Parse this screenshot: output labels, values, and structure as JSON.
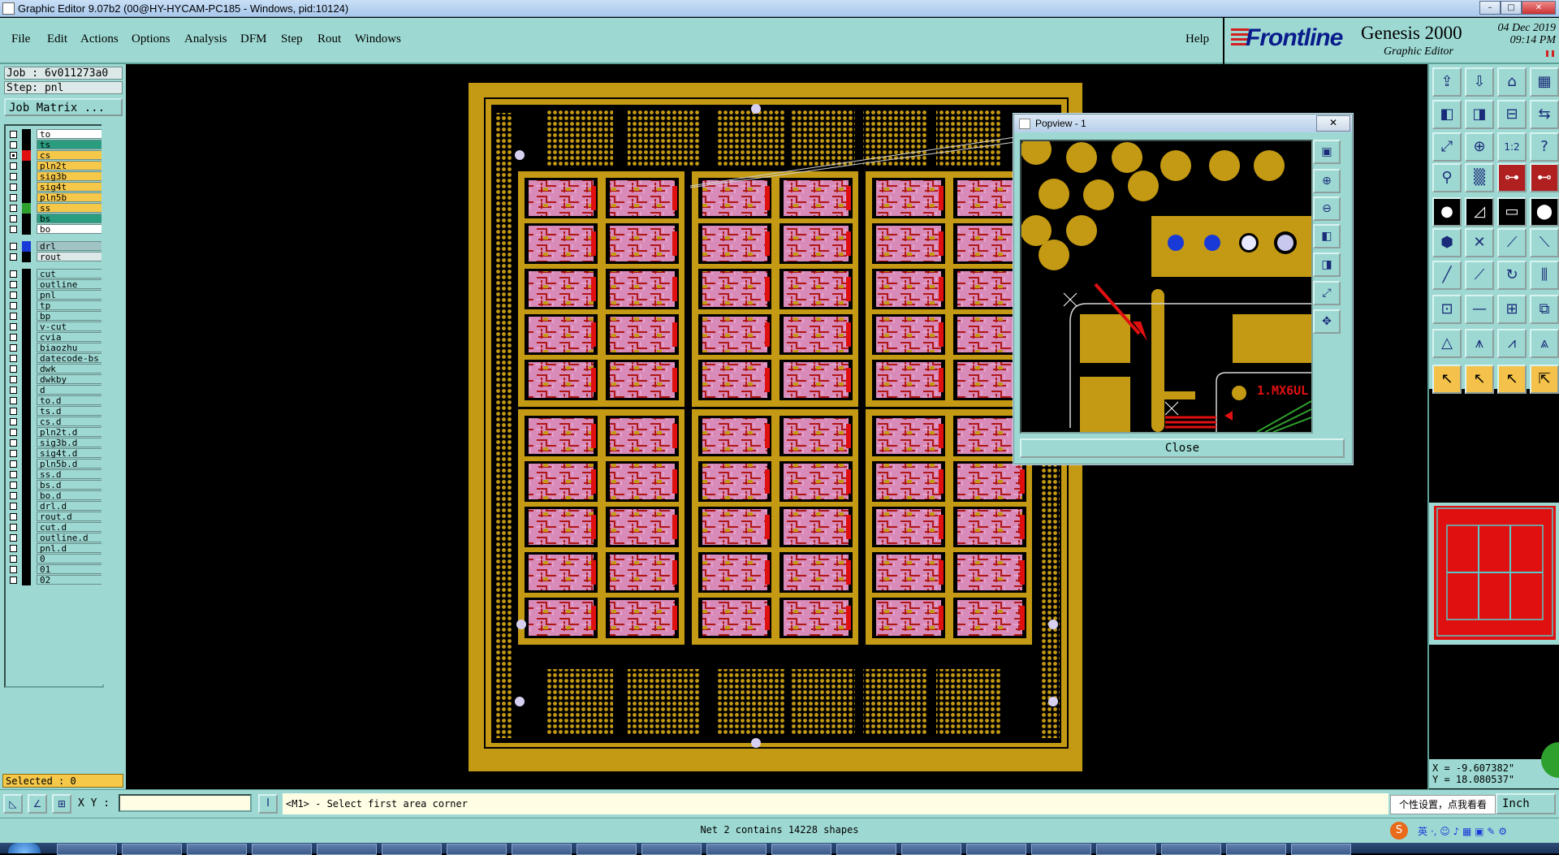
{
  "window": {
    "title": "Graphic Editor 9.07b2 (00@HY-HYCAM-PC185 - Windows, pid:10124)"
  },
  "menu": [
    {
      "label": "File",
      "key": "file"
    },
    {
      "label": "Edit",
      "key": "edit"
    },
    {
      "label": "Actions",
      "key": "actions"
    },
    {
      "label": "Options",
      "key": "options"
    },
    {
      "label": "Analysis",
      "key": "analysis"
    },
    {
      "label": "DFM",
      "key": "dfm"
    },
    {
      "label": "Step",
      "key": "step"
    },
    {
      "label": "Rout",
      "key": "rout"
    },
    {
      "label": "Windows",
      "key": "windows"
    }
  ],
  "help_label": "Help",
  "brand": {
    "logo": "Frontline",
    "product": "Genesis 2000",
    "subtitle": "Graphic Editor",
    "date": "04 Dec 2019",
    "time": "09:14 PM"
  },
  "job": {
    "job_label": "Job : 6v011273a0",
    "step_label": "Step: pnl",
    "matrix_button": "Job Matrix ..."
  },
  "layers": [
    {
      "name": "to",
      "color": "#ffffff",
      "swatch": "#000000",
      "checked": false
    },
    {
      "name": "ts",
      "color": "#2a9d80",
      "swatch": "#000000",
      "checked": false
    },
    {
      "name": "cs",
      "color": "#f6c849",
      "swatch": "#e01010",
      "checked": true
    },
    {
      "name": "pln2t",
      "color": "#f6c849",
      "swatch": "#000000",
      "checked": false
    },
    {
      "name": "sig3b",
      "color": "#f6c849",
      "swatch": "#000000",
      "checked": false
    },
    {
      "name": "sig4t",
      "color": "#f6c849",
      "swatch": "#000000",
      "checked": false
    },
    {
      "name": "pln5b",
      "color": "#f6c849",
      "swatch": "#000000",
      "checked": false
    },
    {
      "name": "ss",
      "color": "#f6c849",
      "swatch": "#2ea02e",
      "checked": false
    },
    {
      "name": "bs",
      "color": "#2a9d80",
      "swatch": "#000000",
      "checked": false
    },
    {
      "name": "bo",
      "color": "#ffffff",
      "swatch": "#000000",
      "checked": false
    },
    {
      "name": "drl",
      "color": "#a0c4c4",
      "swatch": "#1a3ad8",
      "checked": false
    },
    {
      "name": "rout",
      "color": "#dde9e8",
      "swatch": "#000000",
      "checked": false
    },
    {
      "name": "cut",
      "color": "#9dd9d2",
      "swatch": "#000000",
      "checked": false
    },
    {
      "name": "outline",
      "color": "#9dd9d2",
      "swatch": "#000000",
      "checked": false
    },
    {
      "name": "pnl",
      "color": "#9dd9d2",
      "swatch": "#000000",
      "checked": false
    },
    {
      "name": "tp",
      "color": "#9dd9d2",
      "swatch": "#000000",
      "checked": false
    },
    {
      "name": "bp",
      "color": "#9dd9d2",
      "swatch": "#000000",
      "checked": false
    },
    {
      "name": "v-cut",
      "color": "#9dd9d2",
      "swatch": "#000000",
      "checked": false
    },
    {
      "name": "cvia",
      "color": "#9dd9d2",
      "swatch": "#000000",
      "checked": false
    },
    {
      "name": "biaozhu",
      "color": "#9dd9d2",
      "swatch": "#000000",
      "checked": false
    },
    {
      "name": "datecode-bs",
      "color": "#9dd9d2",
      "swatch": "#000000",
      "checked": false
    },
    {
      "name": "dwk",
      "color": "#9dd9d2",
      "swatch": "#000000",
      "checked": false
    },
    {
      "name": "dwkby",
      "color": "#9dd9d2",
      "swatch": "#000000",
      "checked": false
    },
    {
      "name": "d",
      "color": "#9dd9d2",
      "swatch": "#000000",
      "checked": false
    },
    {
      "name": "to.d",
      "color": "#9dd9d2",
      "swatch": "#000000",
      "checked": false
    },
    {
      "name": "ts.d",
      "color": "#9dd9d2",
      "swatch": "#000000",
      "checked": false
    },
    {
      "name": "cs.d",
      "color": "#9dd9d2",
      "swatch": "#000000",
      "checked": false
    },
    {
      "name": "pln2t.d",
      "color": "#9dd9d2",
      "swatch": "#000000",
      "checked": false
    },
    {
      "name": "sig3b.d",
      "color": "#9dd9d2",
      "swatch": "#000000",
      "checked": false
    },
    {
      "name": "sig4t.d",
      "color": "#9dd9d2",
      "swatch": "#000000",
      "checked": false
    },
    {
      "name": "pln5b.d",
      "color": "#9dd9d2",
      "swatch": "#000000",
      "checked": false
    },
    {
      "name": "ss.d",
      "color": "#9dd9d2",
      "swatch": "#000000",
      "checked": false
    },
    {
      "name": "bs.d",
      "color": "#9dd9d2",
      "swatch": "#000000",
      "checked": false
    },
    {
      "name": "bo.d",
      "color": "#9dd9d2",
      "swatch": "#000000",
      "checked": false
    },
    {
      "name": "drl.d",
      "color": "#9dd9d2",
      "swatch": "#000000",
      "checked": false
    },
    {
      "name": "rout.d",
      "color": "#9dd9d2",
      "swatch": "#000000",
      "checked": false
    },
    {
      "name": "cut.d",
      "color": "#9dd9d2",
      "swatch": "#000000",
      "checked": false
    },
    {
      "name": "outline.d",
      "color": "#9dd9d2",
      "swatch": "#000000",
      "checked": false
    },
    {
      "name": "pnl.d",
      "color": "#9dd9d2",
      "swatch": "#000000",
      "checked": false
    },
    {
      "name": "0",
      "color": "#9dd9d2",
      "swatch": "#000000",
      "checked": false
    },
    {
      "name": "01",
      "color": "#9dd9d2",
      "swatch": "#000000",
      "checked": false
    },
    {
      "name": "02",
      "color": "#9dd9d2",
      "swatch": "#000000",
      "checked": false
    }
  ],
  "selected_label": "Selected : 0",
  "popview": {
    "title": "Popview - 1",
    "close_label": "Close",
    "board_text": "1.MX6UL"
  },
  "coords": {
    "x": "X = -9.607382\"",
    "y": "Y = 18.080537\""
  },
  "bottom": {
    "xy_label": "X Y :",
    "xy_value": "",
    "prompt": "<M1> - Select first area corner",
    "units": "Inch",
    "tooltip": "个性设置，点我看看"
  },
  "status": "Net 2 contains 14228 shapes",
  "colors": {
    "panel": "#9dd9d2",
    "copper": "#c49a14",
    "layer_cs": "#f6c849",
    "accent_red": "#e01010"
  }
}
